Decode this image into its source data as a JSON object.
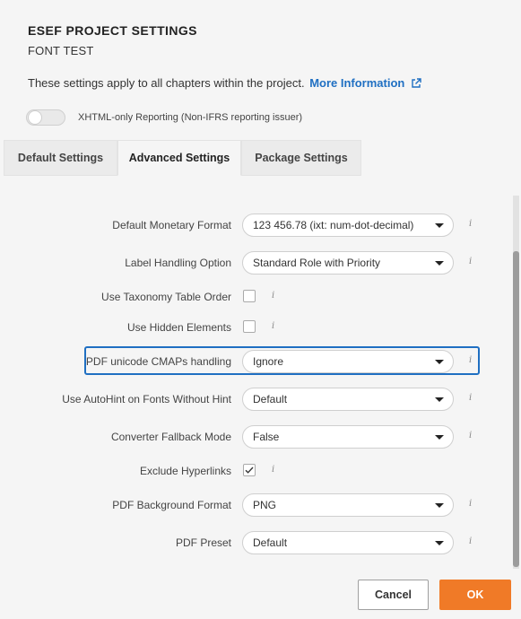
{
  "header": {
    "title": "ESEF PROJECT SETTINGS",
    "subtitle": "FONT TEST",
    "info_text": "These settings apply to all chapters within the project.",
    "info_link": "More Information"
  },
  "toggle": {
    "label": "XHTML-only Reporting (Non-IFRS reporting issuer)",
    "checked": false
  },
  "tabs": [
    {
      "label": "Default Settings"
    },
    {
      "label": "Advanced Settings",
      "active": true
    },
    {
      "label": "Package Settings"
    }
  ],
  "settings": {
    "default_monetary_format": {
      "label": "Default Monetary Format",
      "value": "123 456.78 (ixt: num-dot-decimal)"
    },
    "label_handling_option": {
      "label": "Label Handling Option",
      "value": "Standard Role with Priority"
    },
    "use_taxonomy_table_order": {
      "label": "Use Taxonomy Table Order",
      "checked": false
    },
    "use_hidden_elements": {
      "label": "Use Hidden Elements",
      "checked": false
    },
    "pdf_unicode_cmaps": {
      "label": "PDF unicode CMAPs handling",
      "value": "Ignore"
    },
    "use_autohint": {
      "label": "Use AutoHint on Fonts Without Hint",
      "value": "Default"
    },
    "converter_fallback_mode": {
      "label": "Converter Fallback Mode",
      "value": "False"
    },
    "exclude_hyperlinks": {
      "label": "Exclude Hyperlinks",
      "checked": true
    },
    "pdf_background_format": {
      "label": "PDF Background Format",
      "value": "PNG"
    },
    "pdf_preset": {
      "label": "PDF Preset",
      "value": "Default"
    }
  },
  "info_icon_glyph": "i",
  "footer": {
    "cancel_label": "Cancel",
    "ok_label": "OK"
  },
  "colors": {
    "accent": "#1f6fc2",
    "ok_button": "#f07a27"
  }
}
